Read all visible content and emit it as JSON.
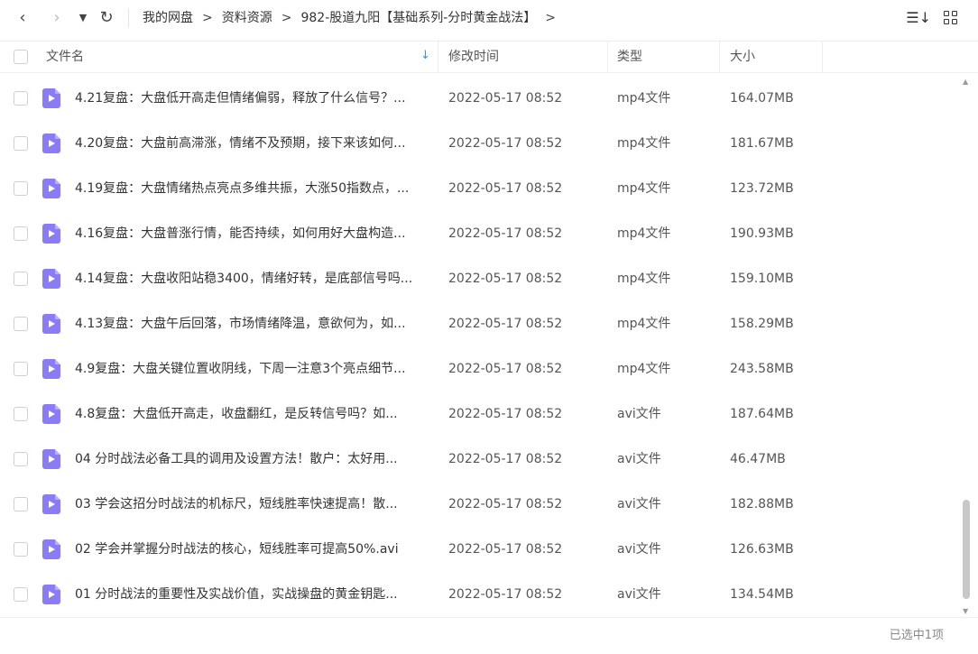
{
  "toolbar": {
    "back_icon": "‹",
    "forward_icon": "›",
    "dropdown_icon": "▼",
    "refresh_icon": "↻",
    "sort_icon": "☰↓"
  },
  "breadcrumb": {
    "items": [
      "我的网盘",
      "资料资源",
      "982-股道九阳【基础系列-分时黄金战法】"
    ],
    "separator": ">"
  },
  "header": {
    "name": "文件名",
    "modified": "修改时间",
    "type": "类型",
    "size": "大小",
    "sort_arrow": "↓"
  },
  "rows": [
    {
      "name": "4.21复盘：大盘低开高走但情绪偏弱，释放了什么信号？...",
      "modified": "2022-05-17 08:52",
      "type": "mp4文件",
      "size": "164.07MB"
    },
    {
      "name": "4.20复盘：大盘前高滞涨，情绪不及预期，接下来该如何...",
      "modified": "2022-05-17 08:52",
      "type": "mp4文件",
      "size": "181.67MB"
    },
    {
      "name": "4.19复盘：大盘情绪热点亮点多维共振，大涨50指数点，...",
      "modified": "2022-05-17 08:52",
      "type": "mp4文件",
      "size": "123.72MB"
    },
    {
      "name": "4.16复盘：大盘普涨行情，能否持续，如何用好大盘构造...",
      "modified": "2022-05-17 08:52",
      "type": "mp4文件",
      "size": "190.93MB"
    },
    {
      "name": "4.14复盘：大盘收阳站稳3400，情绪好转，是底部信号吗...",
      "modified": "2022-05-17 08:52",
      "type": "mp4文件",
      "size": "159.10MB"
    },
    {
      "name": "4.13复盘：大盘午后回落，市场情绪降温，意欲何为，如...",
      "modified": "2022-05-17 08:52",
      "type": "mp4文件",
      "size": "158.29MB"
    },
    {
      "name": "4.9复盘：大盘关键位置收阴线，下周一注意3个亮点细节...",
      "modified": "2022-05-17 08:52",
      "type": "mp4文件",
      "size": "243.58MB"
    },
    {
      "name": "4.8复盘：大盘低开高走，收盘翻红，是反转信号吗？如...",
      "modified": "2022-05-17 08:52",
      "type": "avi文件",
      "size": "187.64MB"
    },
    {
      "name": "04 分时战法必备工具的调用及设置方法！散户：太好用...",
      "modified": "2022-05-17 08:52",
      "type": "avi文件",
      "size": "46.47MB"
    },
    {
      "name": "03 学会这招分时战法的机标尺，短线胜率快速提高！散...",
      "modified": "2022-05-17 08:52",
      "type": "avi文件",
      "size": "182.88MB"
    },
    {
      "name": "02 学会并掌握分时战法的核心，短线胜率可提高50%.avi",
      "modified": "2022-05-17 08:52",
      "type": "avi文件",
      "size": "126.63MB"
    },
    {
      "name": "01 分时战法的重要性及实战价值，实战操盘的黄金钥匙...",
      "modified": "2022-05-17 08:52",
      "type": "avi文件",
      "size": "134.54MB"
    }
  ],
  "scrollbar": {
    "up_icon": "▲",
    "down_icon": "▼"
  },
  "footer": {
    "status": "已选中1项"
  },
  "colors": {
    "accent": "#3b8cf5",
    "video_icon": "#8a7cf5"
  }
}
